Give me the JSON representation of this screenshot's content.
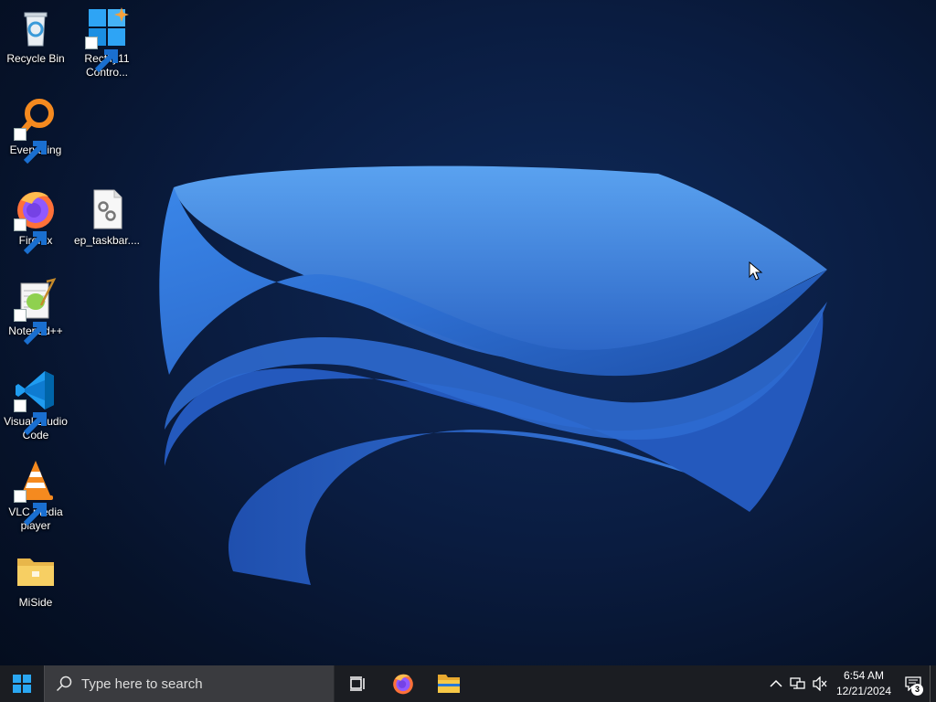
{
  "desktop": {
    "icons": [
      {
        "label": "Recycle Bin",
        "icon": "recycle-bin-icon"
      },
      {
        "label": "Rectify11 Contro...",
        "icon": "control-panel-icon"
      },
      {
        "label": "Everything",
        "icon": "everything-search-icon"
      },
      {
        "label": "Firefox",
        "icon": "firefox-icon"
      },
      {
        "label": "ep_taskbar....",
        "icon": "settings-file-icon"
      },
      {
        "label": "Notepad++",
        "icon": "notepadpp-icon"
      },
      {
        "label": "Visual Studio Code",
        "icon": "vscode-icon"
      },
      {
        "label": "VLC media player",
        "icon": "vlc-icon"
      },
      {
        "label": "MiSide",
        "icon": "folder-icon"
      }
    ]
  },
  "taskbar": {
    "search_placeholder": "Type here to search",
    "time": "6:54 AM",
    "date": "12/21/2024",
    "notification_count": "3",
    "pinned": [
      "task-view-icon",
      "firefox-icon",
      "file-explorer-icon"
    ],
    "tray": [
      "chevron-up-icon",
      "network-icon",
      "volume-muted-icon"
    ]
  },
  "colors": {
    "taskbar_bg": "#1b1d22",
    "search_bg": "#3a3b3f",
    "wallpaper_bg": "#0a1c40",
    "ribbon_blue": "#2f6fd0",
    "start_blue": "#2aa7f2"
  }
}
